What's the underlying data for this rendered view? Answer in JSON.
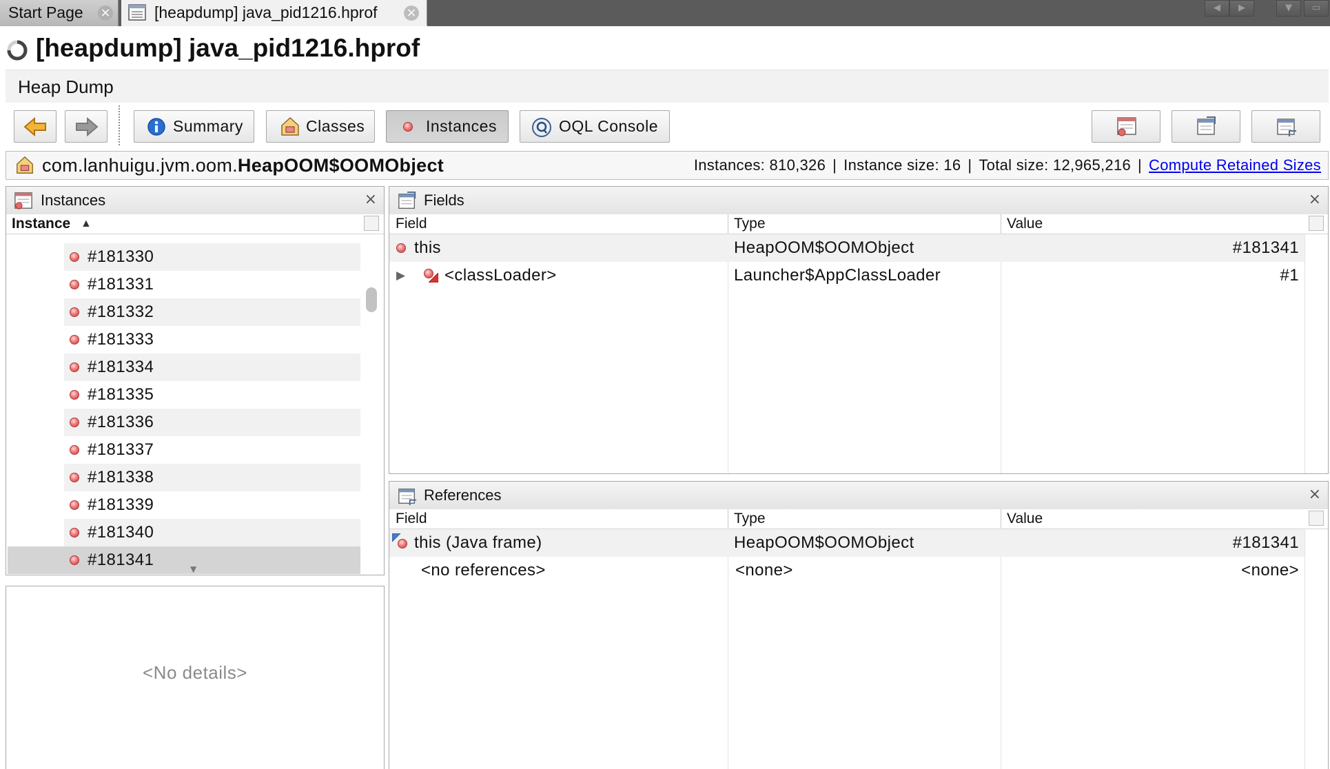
{
  "tabs": [
    {
      "label": "Start Page",
      "active": false
    },
    {
      "label": "[heapdump] java_pid1216.hprof",
      "active": true
    }
  ],
  "tab_close_glyph": "×",
  "title": "[heapdump] java_pid1216.hprof",
  "subtitle": "Heap Dump",
  "toolbar": {
    "back_icon": "back-arrow-icon",
    "forward_icon": "forward-arrow-icon",
    "views": [
      {
        "label": "Summary",
        "icon": "info-icon",
        "pressed": false
      },
      {
        "label": "Classes",
        "icon": "classes-icon",
        "pressed": false
      },
      {
        "label": "Instances",
        "icon": "instance-dot-icon",
        "pressed": true
      },
      {
        "label": "OQL Console",
        "icon": "oql-icon",
        "pressed": false
      }
    ],
    "right_buttons": [
      "instances-view-icon",
      "fields-view-icon",
      "references-view-icon"
    ]
  },
  "classbar": {
    "package": "com.lanhuigu.jvm.oom.",
    "class_simple": "HeapOOM$OOMObject",
    "instances": "Instances: 810,326",
    "instance_size": "Instance size: 16",
    "total_size": "Total size: 12,965,216",
    "separator": "|",
    "compute_link": "Compute Retained Sizes"
  },
  "instances_panel": {
    "title": "Instances",
    "close": "×",
    "column": "Instance",
    "sort_indicator": "▲",
    "items": [
      "#181330",
      "#181331",
      "#181332",
      "#181333",
      "#181334",
      "#181335",
      "#181336",
      "#181337",
      "#181338",
      "#181339",
      "#181340",
      "#181341"
    ],
    "selected": "#181341",
    "details_placeholder": "<No details>"
  },
  "fields_panel": {
    "title": "Fields",
    "close": "×",
    "columns": [
      "Field",
      "Type",
      "Value"
    ],
    "rows": [
      {
        "field": "this",
        "type": "HeapOOM$OOMObject",
        "value": "#181341",
        "expandable": false
      },
      {
        "field": "<classLoader>",
        "type": "Launcher$AppClassLoader",
        "value": "#1",
        "expandable": true
      }
    ]
  },
  "references_panel": {
    "title": "References",
    "close": "×",
    "columns": [
      "Field",
      "Type",
      "Value"
    ],
    "rows": [
      {
        "field": "this (Java frame)",
        "type": "HeapOOM$OOMObject",
        "value": "#181341"
      },
      {
        "field": "<no references>",
        "type": "<none>",
        "value": "<none>"
      }
    ]
  }
}
